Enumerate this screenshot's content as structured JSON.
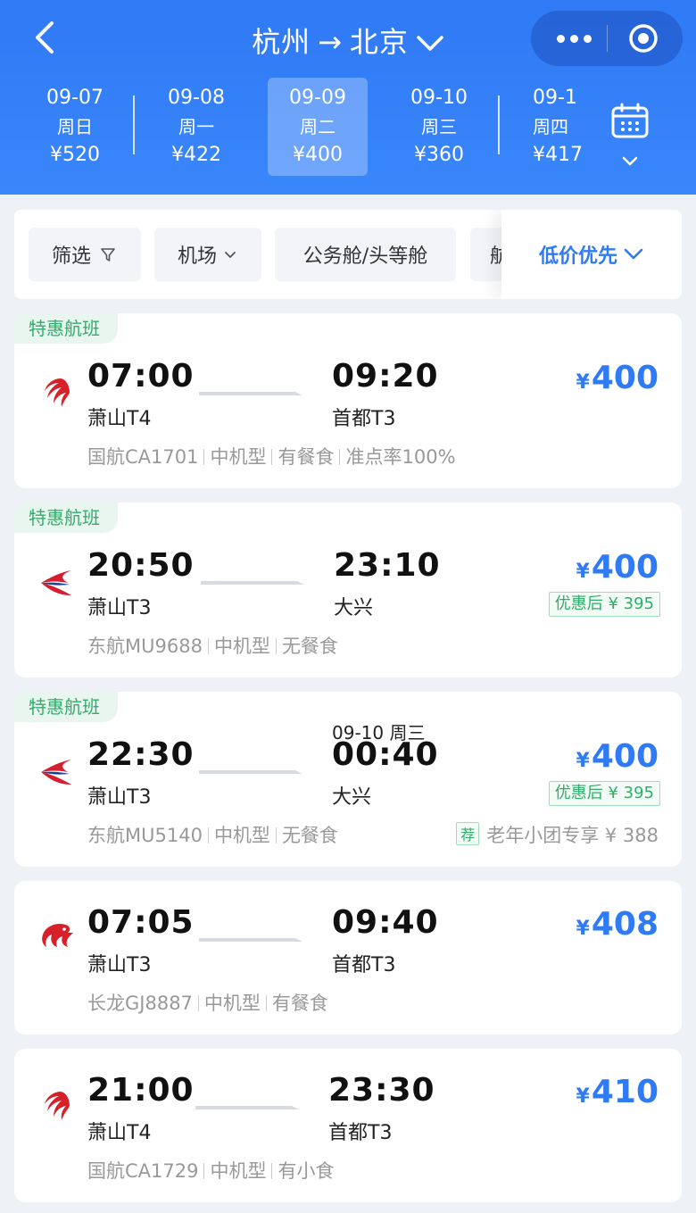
{
  "header": {
    "from": "杭州",
    "to": "北京",
    "arrow": "→"
  },
  "dates": [
    {
      "date": "09-07",
      "weekday": "周日",
      "price": "¥520"
    },
    {
      "date": "09-08",
      "weekday": "周一",
      "price": "¥422"
    },
    {
      "date": "09-09",
      "weekday": "周二",
      "price": "¥400"
    },
    {
      "date": "09-10",
      "weekday": "周三",
      "price": "¥360"
    },
    {
      "date": "09-1",
      "weekday": "周四",
      "price": "¥417"
    }
  ],
  "filters": {
    "filter": "筛选",
    "airport": "机场",
    "cabin": "公务舱/头等舱",
    "partial": "航",
    "sort": "低价优先"
  },
  "flights": [
    {
      "tag": "特惠航班",
      "dep_time": "07:00",
      "dep_airport": "萧山T4",
      "arr_time": "09:20",
      "arr_airport": "首都T3",
      "price_symbol": "¥",
      "price": "400",
      "airline_flight": "国航CA1701",
      "aircraft": "中机型",
      "meal": "有餐食",
      "ontime": "准点率100%",
      "airline_icon": "air-china-logo"
    },
    {
      "tag": "特惠航班",
      "dep_time": "20:50",
      "dep_airport": "萧山T3",
      "arr_time": "23:10",
      "arr_airport": "大兴",
      "price_symbol": "¥",
      "price": "400",
      "discount": "优惠后 ¥ 395",
      "airline_flight": "东航MU9688",
      "aircraft": "中机型",
      "meal": "无餐食",
      "airline_icon": "china-eastern-logo"
    },
    {
      "tag": "特惠航班",
      "dep_time": "22:30",
      "dep_airport": "萧山T3",
      "arr_time": "00:40",
      "arr_airport": "大兴",
      "arr_next_day": "09-10 周三",
      "price_symbol": "¥",
      "price": "400",
      "discount": "优惠后 ¥ 395",
      "airline_flight": "东航MU5140",
      "aircraft": "中机型",
      "meal": "无餐食",
      "rec_tag": "荐",
      "senior": "老年小团专享 ¥ 388",
      "airline_icon": "china-eastern-logo"
    },
    {
      "dep_time": "07:05",
      "dep_airport": "萧山T3",
      "arr_time": "09:40",
      "arr_airport": "首都T3",
      "price_symbol": "¥",
      "price": "408",
      "airline_flight": "长龙GJ8887",
      "aircraft": "中机型",
      "meal": "有餐食",
      "airline_icon": "loong-air-logo"
    },
    {
      "dep_time": "21:00",
      "dep_airport": "萧山T4",
      "arr_time": "23:30",
      "arr_airport": "首都T3",
      "price_symbol": "¥",
      "price": "410",
      "airline_flight": "国航CA1729",
      "aircraft": "中机型",
      "meal": "有小食",
      "airline_icon": "air-china-logo"
    }
  ],
  "colors": {
    "brand_blue": "#2f7af5",
    "green": "#2fae6a",
    "air_china_red": "#d6202a",
    "eastern_red": "#d71e30",
    "eastern_blue": "#1f3f93"
  }
}
